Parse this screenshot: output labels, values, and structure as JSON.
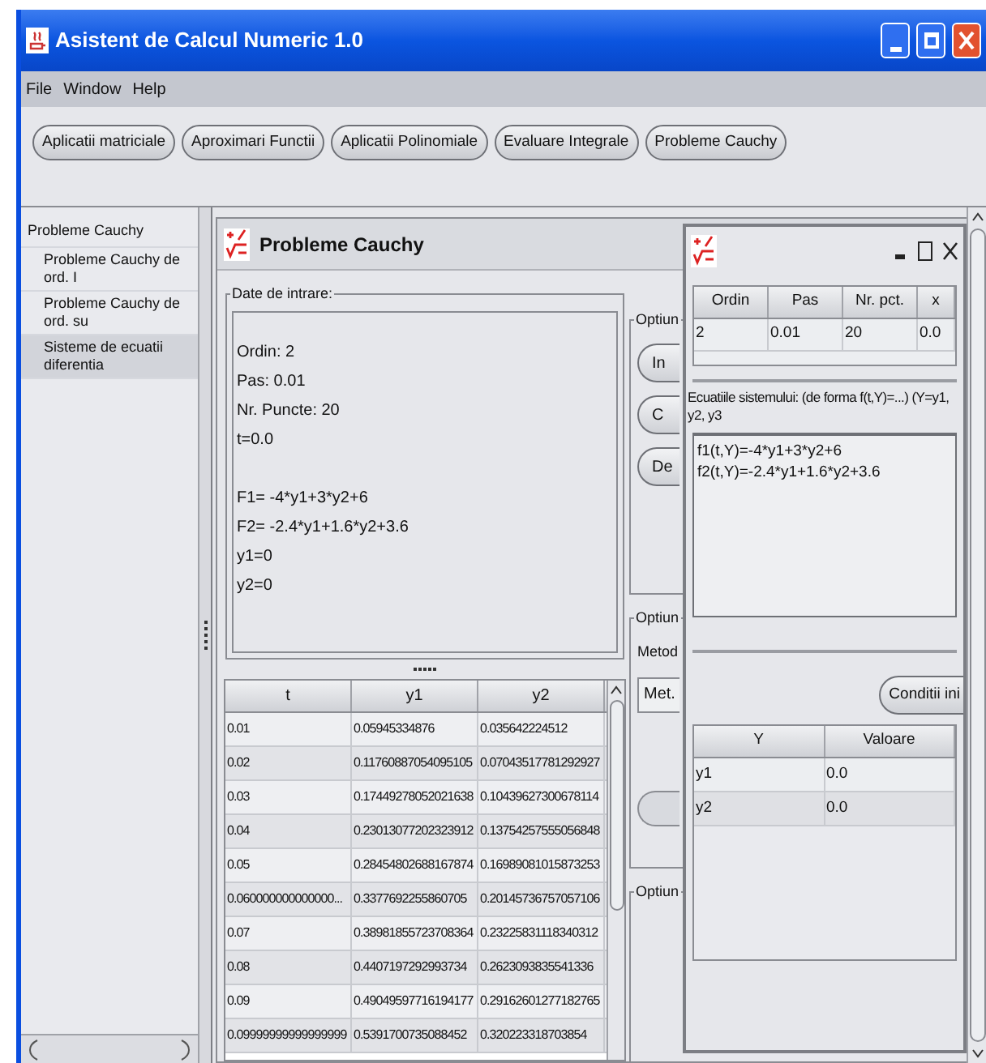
{
  "window": {
    "title": "Asistent de Calcul Numeric 1.0"
  },
  "menu": [
    "File",
    "Window",
    "Help"
  ],
  "toolbar": [
    "Aplicatii matriciale",
    "Aproximari Functii",
    "Aplicatii Polinomiale",
    "Evaluare Integrale",
    "Probleme Cauchy"
  ],
  "sidebar": {
    "items": [
      {
        "label": "Probleme Cauchy",
        "selected": false,
        "children": [
          {
            "label": "Probleme Cauchy de ord. I",
            "selected": false
          },
          {
            "label": "Probleme Cauchy de ord. su",
            "selected": false
          },
          {
            "label": "Sisteme de ecuatii diferentia",
            "selected": true
          }
        ]
      }
    ]
  },
  "cauchy_frame": {
    "title": "Probleme Cauchy",
    "input_group": {
      "legend": "Date de intrare:",
      "parameters": [
        "Ordin: 2",
        "Pas: 0.01",
        "Nr. Puncte: 20",
        "t=0.0"
      ],
      "functions": [
        "F1= -4*y1+3*y2+6",
        "F2= -2.4*y1+1.6*y2+3.6",
        "y1=0",
        "y2=0"
      ]
    },
    "results": {
      "columns": [
        "t",
        "y1",
        "y2"
      ],
      "rows": [
        [
          "0.01",
          "0.05945334876",
          "0.035642224512"
        ],
        [
          "0.02",
          "0.11760887054095105",
          "0.07043517781292927"
        ],
        [
          "0.03",
          "0.17449278052021638",
          "0.10439627300678114"
        ],
        [
          "0.04",
          "0.23013077202323912",
          "0.13754257555056848"
        ],
        [
          "0.05",
          "0.28454802688167874",
          "0.16989081015873253"
        ],
        [
          "0.060000000000000...",
          "0.3377692255860705",
          "0.20145736757057106"
        ],
        [
          "0.07",
          "0.38981855723708364",
          "0.23225831118340312"
        ],
        [
          "0.08",
          "0.4407197292993734",
          "0.2623093835541336"
        ],
        [
          "0.09",
          "0.49049597716194177",
          "0.29162601277182765"
        ],
        [
          "0.09999999999999999",
          "0.5391700735088452",
          "0.320223318703854"
        ]
      ]
    },
    "options": {
      "group_1": {
        "legend": "Optiun",
        "buttons": [
          "In",
          "C",
          "De"
        ]
      },
      "group_2": {
        "legend": "Optiun",
        "label": "Metod",
        "tab": "Met."
      },
      "group_3": {
        "legend": "Optiun"
      }
    }
  },
  "system_frame": {
    "params": {
      "columns": [
        "Ordin",
        "Pas",
        "Nr. pct.",
        "x"
      ],
      "rows": [
        [
          "2",
          "0.01",
          "20",
          "0.0"
        ]
      ]
    },
    "equations_label": "Ecuatiile sistemului: (de forma f(t,Y)=...)  (Y=y1, y2, y3",
    "equations": [
      "f1(t,Y)=-4*y1+3*y2+6",
      "f2(t,Y)=-2.4*y1+1.6*y2+3.6"
    ],
    "conditions_button": "Conditii ini",
    "conditions": {
      "columns": [
        "Y",
        "Valoare"
      ],
      "rows": [
        [
          "y1",
          "0.0"
        ],
        [
          "y2",
          "0.0"
        ]
      ]
    }
  }
}
